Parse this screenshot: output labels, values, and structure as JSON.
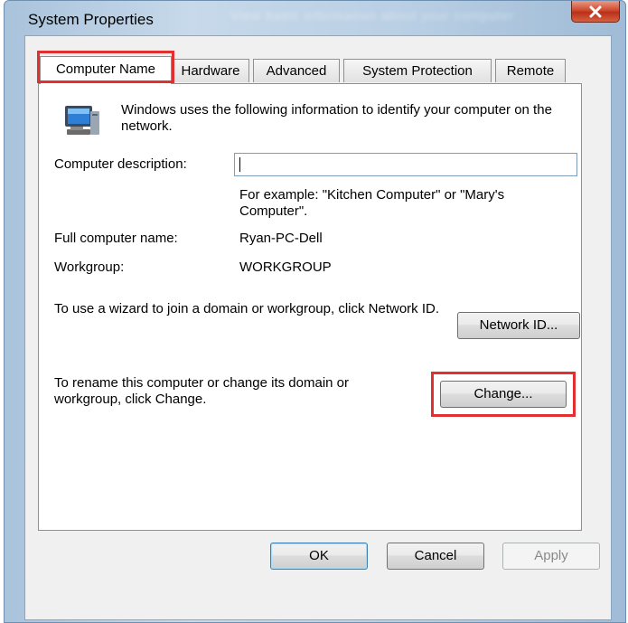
{
  "window": {
    "title": "System Properties",
    "background_title": "View basic information about your computer"
  },
  "tabs": [
    {
      "label": "Computer Name",
      "active": true
    },
    {
      "label": "Hardware",
      "active": false
    },
    {
      "label": "Advanced",
      "active": false
    },
    {
      "label": "System Protection",
      "active": false
    },
    {
      "label": "Remote",
      "active": false
    }
  ],
  "panel": {
    "intro": "Windows uses the following information to identify your computer on the network.",
    "description_label": "Computer description:",
    "description_value": "",
    "example_text": "For example: \"Kitchen Computer\" or \"Mary's Computer\".",
    "full_name_label": "Full computer name:",
    "full_name_value": "Ryan-PC-Dell",
    "workgroup_label": "Workgroup:",
    "workgroup_value": "WORKGROUP",
    "network_id_text": "To use a wizard to join a domain or workgroup, click Network ID.",
    "network_id_button": "Network ID...",
    "rename_text": "To rename this computer or change its domain or workgroup, click Change.",
    "change_button": "Change..."
  },
  "buttons": {
    "ok": "OK",
    "cancel": "Cancel",
    "apply": "Apply"
  },
  "colors": {
    "highlight": "#e03030",
    "close_button": "#cf4a2e",
    "title_bar": "#b9cfe4"
  },
  "icons": {
    "close": "close-x-icon",
    "computer": "computer-network-icon"
  }
}
